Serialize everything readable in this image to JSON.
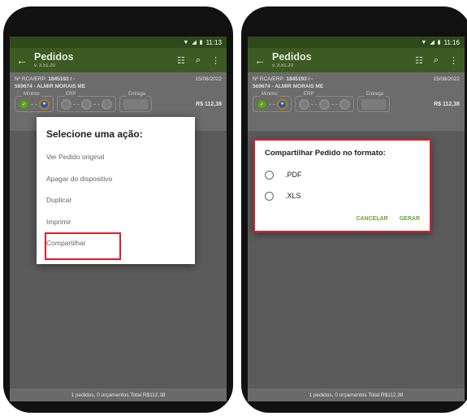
{
  "colors": {
    "accent": "#6aa33a",
    "highlight": "#d62027",
    "appbar": "#3d5a22"
  },
  "left": {
    "status": {
      "time": "11:13"
    },
    "appbar": {
      "title": "Pedidos",
      "version": "v. 3.51.20"
    },
    "order": {
      "rca": "Nº RCA/ERP: ",
      "rca_number": "1845193 / -",
      "date": "15/08/2022",
      "customer": "569674 - ALMIR MORAIS ME",
      "stage_minimo": "Mínimo",
      "stage_erp": "ERP",
      "stage_entrega": "Entrega",
      "amount": "R$ 112,38"
    },
    "dialog": {
      "title": "Selecione uma ação:",
      "items": [
        "Ver Pedido original",
        "Apagar do dispositivo",
        "Duplicar",
        "Imprimir",
        "Compartilhar"
      ]
    },
    "footer": "1 pedidos, 0 orçamentos  Total R$112,38"
  },
  "right": {
    "status": {
      "time": "11:16"
    },
    "appbar": {
      "title": "Pedidos",
      "version": "v. 3.51.20"
    },
    "order": {
      "rca": "Nº RCA/ERP: ",
      "rca_number": "1845193 / -",
      "date": "15/08/2022",
      "customer": "569674 - ALMIR MORAIS ME",
      "stage_minimo": "Mínimo",
      "stage_erp": "ERP",
      "stage_entrega": "Entrega",
      "amount": "R$ 112,38"
    },
    "dialog": {
      "title": "Compartilhar Pedido no formato:",
      "options": [
        ".PDF",
        ".XLS"
      ],
      "cancel": "CANCELAR",
      "confirm": "GERAR"
    },
    "footer": "1 pedidos, 0 orçamentos  Total R$112,38"
  },
  "icons": {
    "back": "arrow-left-icon",
    "filter": "sliders-icon",
    "search": "search-icon",
    "more": "more-vertical-icon"
  }
}
